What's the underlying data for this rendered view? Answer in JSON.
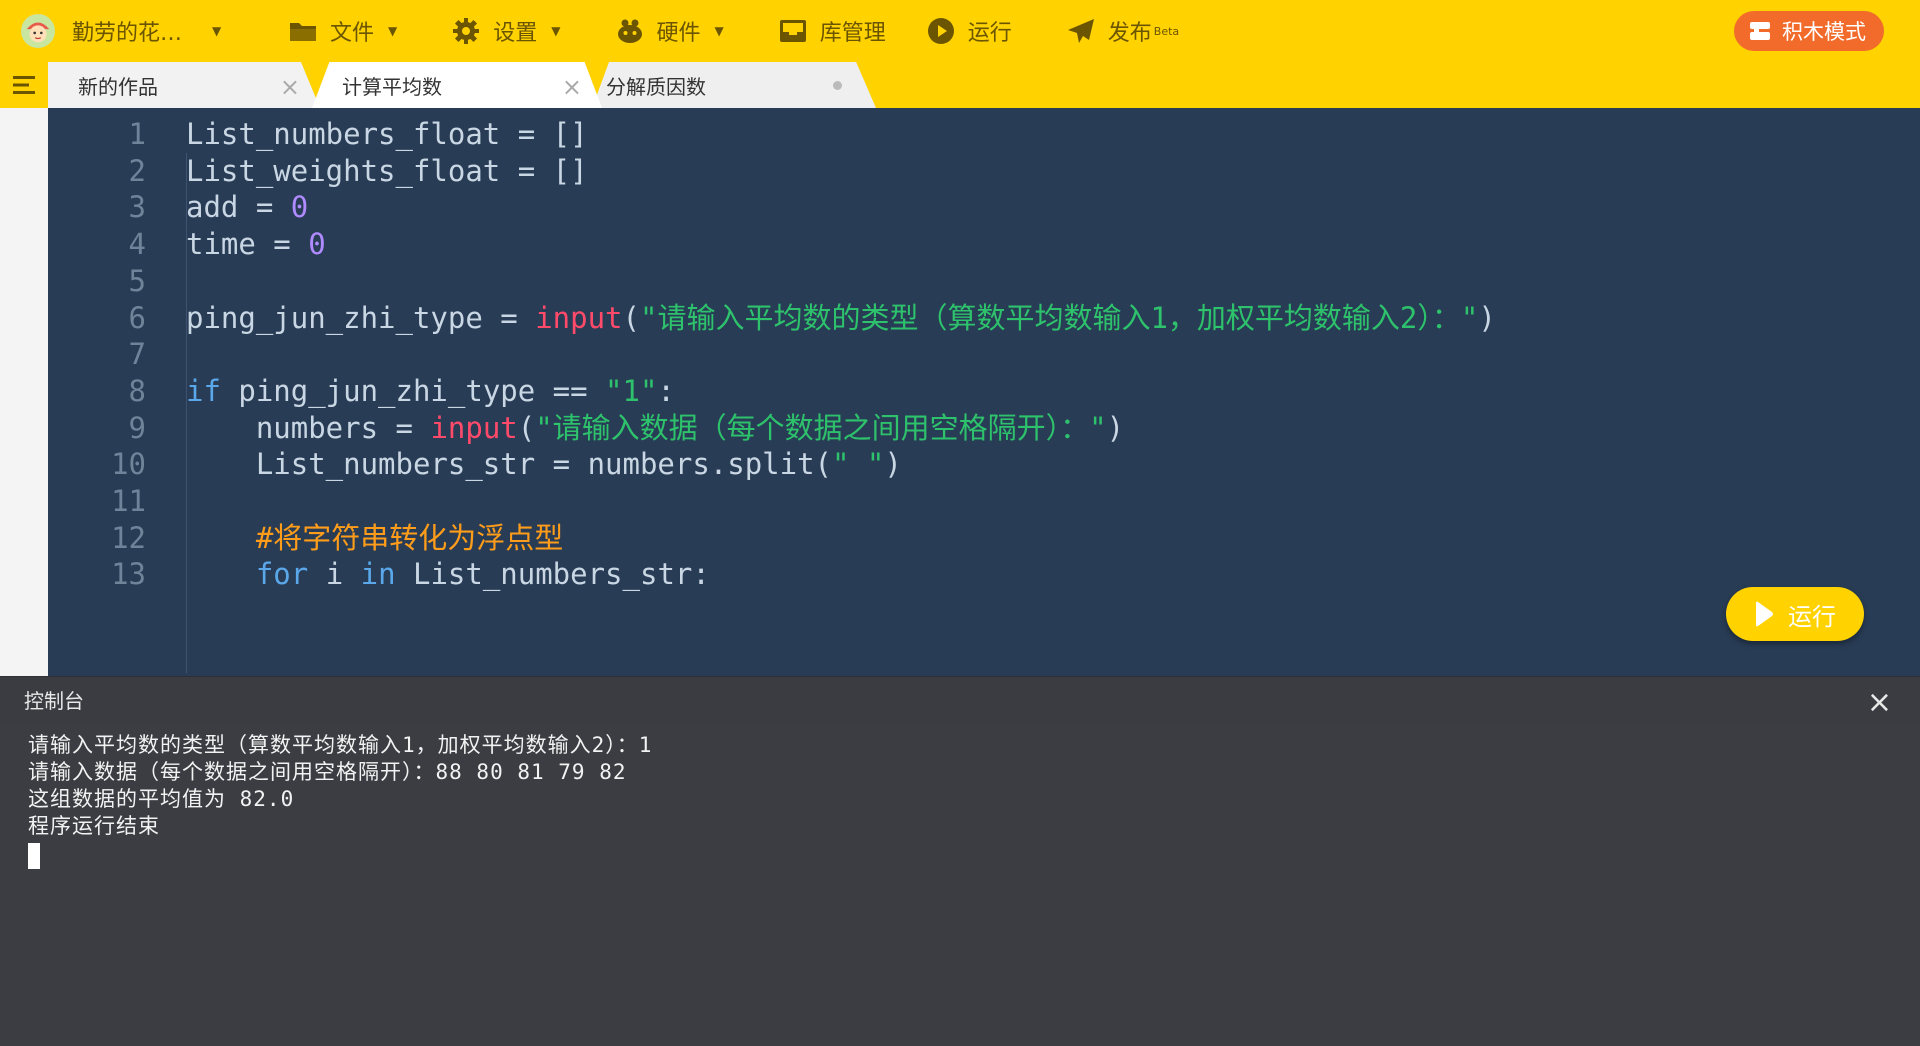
{
  "topbar": {
    "username": "勤劳的花…",
    "menu": [
      {
        "label": "文件",
        "icon": "folder-icon",
        "has_caret": true
      },
      {
        "label": "设置",
        "icon": "gear-icon",
        "has_caret": true
      },
      {
        "label": "硬件",
        "icon": "robot-icon",
        "has_caret": true
      },
      {
        "label": "库管理",
        "icon": "inbox-icon",
        "has_caret": false
      },
      {
        "label": "运行",
        "icon": "play-circle-icon",
        "has_caret": false
      },
      {
        "label": "发布",
        "icon": "paper-plane-icon",
        "has_caret": false,
        "badge": "Beta"
      }
    ],
    "block_mode_label": "积木模式"
  },
  "tabs": [
    {
      "label": "新的作品",
      "state": "inactive",
      "control": "×"
    },
    {
      "label": "计算平均数",
      "state": "active",
      "control": "×"
    },
    {
      "label": "分解质因数",
      "state": "inactive",
      "control": "●"
    }
  ],
  "editor": {
    "lines": [
      {
        "n": "1",
        "code": "List_numbers_float = []"
      },
      {
        "n": "2",
        "code": "List_weights_float = []"
      },
      {
        "n": "3",
        "code": "add = 0"
      },
      {
        "n": "4",
        "code": "time = 0"
      },
      {
        "n": "5",
        "code": ""
      },
      {
        "n": "6",
        "code": "ping_jun_zhi_type = input(\"请输入平均数的类型（算数平均数输入1，加权平均数输入2）：\")"
      },
      {
        "n": "7",
        "code": ""
      },
      {
        "n": "8",
        "code": "if ping_jun_zhi_type == \"1\":"
      },
      {
        "n": "9",
        "code": "    numbers = input(\"请输入数据（每个数据之间用空格隔开）：\")"
      },
      {
        "n": "10",
        "code": "    List_numbers_str = numbers.split(\" \")"
      },
      {
        "n": "11",
        "code": ""
      },
      {
        "n": "12",
        "code": "    #将字符串转化为浮点型"
      },
      {
        "n": "13",
        "code": "    for i in List_numbers_str:"
      }
    ],
    "run_button_label": "运行"
  },
  "console": {
    "title": "控制台",
    "close": "×",
    "lines": [
      "请输入平均数的类型（算数平均数输入1，加权平均数输入2）：1",
      "请输入数据（每个数据之间用空格隔开）：88 80 81 79 82",
      "这组数据的平均值为 82.0",
      "程序运行结束"
    ]
  },
  "colors": {
    "topbar": "#ffd200",
    "editor_bg": "#283c55",
    "keyword": "#5aa7ea",
    "builtin": "#ff4a6a",
    "string": "#2dc26b",
    "number": "#b08bff",
    "comment": "#ff9d1a",
    "block_mode": "#f26b2b",
    "console_bg": "#3b3d42"
  }
}
